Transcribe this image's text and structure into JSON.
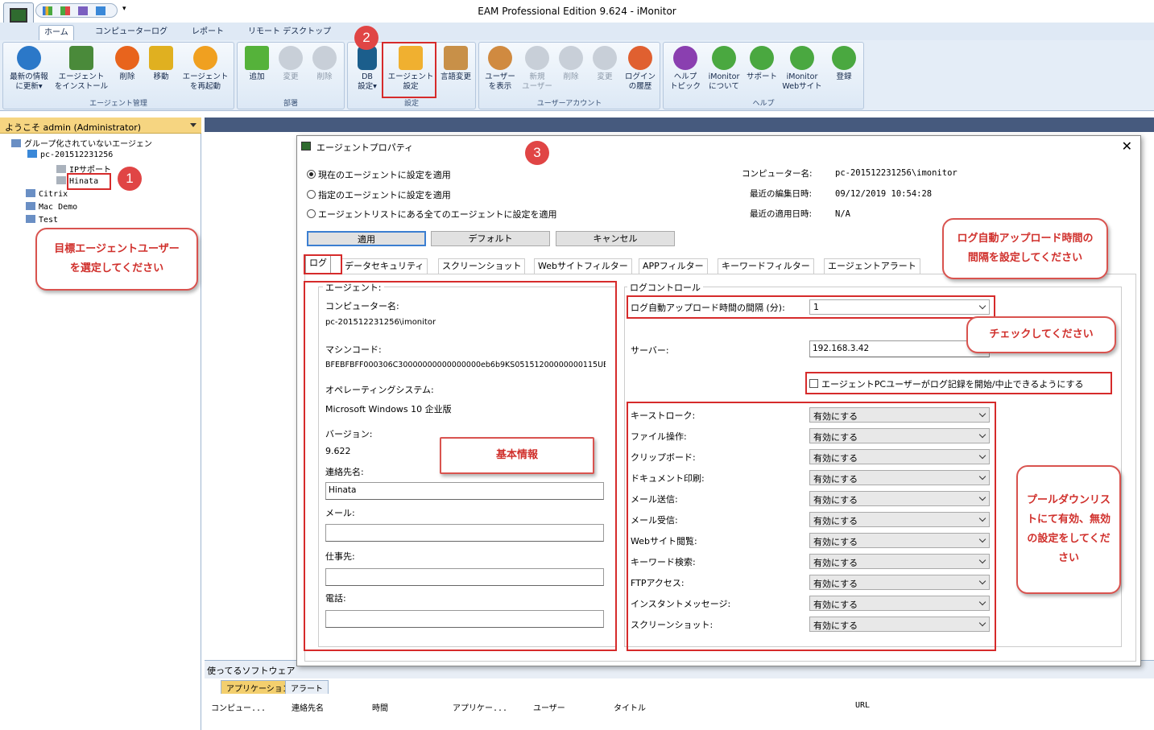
{
  "app": {
    "title": "EAM Professional Edition 9.624 - iMonitor"
  },
  "ribbon_tabs": [
    "ホーム",
    "コンピューターログ",
    "レポート",
    "リモート デスクトップ"
  ],
  "ribbon": {
    "groups": [
      {
        "label": "エージェント管理",
        "buttons": [
          {
            "l1": "最新の情報",
            "l2": "に更新▾",
            "icon": "refresh-icon",
            "color": "#2b78c8"
          },
          {
            "l1": "エージェント",
            "l2": "をインストール",
            "icon": "install-agent-icon",
            "color": "#4a8a3a"
          },
          {
            "l1": "削除",
            "l2": "",
            "icon": "delete-icon",
            "color": "#e8641d"
          },
          {
            "l1": "移動",
            "l2": "",
            "icon": "move-icon",
            "color": "#e0b020"
          },
          {
            "l1": "エージェント",
            "l2": "を再起動",
            "icon": "restart-icon",
            "color": "#f0a020"
          }
        ]
      },
      {
        "label": "部署",
        "buttons": [
          {
            "l1": "追加",
            "l2": "",
            "icon": "add-icon",
            "color": "#55b23a"
          },
          {
            "l1": "変更",
            "l2": "",
            "icon": "edit-icon",
            "color": "#c8cfd8"
          },
          {
            "l1": "削除",
            "l2": "",
            "icon": "delete-dept-icon",
            "color": "#c8cfd8"
          }
        ]
      },
      {
        "label": "設定",
        "buttons": [
          {
            "l1": "DB",
            "l2": "設定▾",
            "icon": "database-icon",
            "color": "#1b5e8c"
          },
          {
            "l1": "エージェント",
            "l2": "設定",
            "icon": "agent-settings-icon",
            "color": "#f0b030"
          },
          {
            "l1": "言語変更",
            "l2": "",
            "icon": "language-icon",
            "color": "#c89048"
          }
        ]
      },
      {
        "label": "ユーザーアカウント",
        "buttons": [
          {
            "l1": "ユーザー",
            "l2": "を表示",
            "icon": "users-icon",
            "color": "#d08a40"
          },
          {
            "l1": "新規",
            "l2": "ユーザー",
            "icon": "new-user-icon",
            "color": "#c8cfd8"
          },
          {
            "l1": "削除",
            "l2": "",
            "icon": "delete-user-icon",
            "color": "#c8cfd8"
          },
          {
            "l1": "変更",
            "l2": "",
            "icon": "edit-user-icon",
            "color": "#c8cfd8"
          },
          {
            "l1": "ログイン",
            "l2": "の履歴",
            "icon": "login-history-icon",
            "color": "#e06030"
          }
        ]
      },
      {
        "label": "ヘルプ",
        "buttons": [
          {
            "l1": "ヘルプ",
            "l2": "トピック",
            "icon": "help-icon",
            "color": "#8a3fb0"
          },
          {
            "l1": "iMonitor",
            "l2": "について",
            "icon": "about-icon",
            "color": "#4aa840"
          },
          {
            "l1": "サポート",
            "l2": "",
            "icon": "support-icon",
            "color": "#4aa840"
          },
          {
            "l1": "iMonitor",
            "l2": "Webサイト",
            "icon": "website-icon",
            "color": "#4aa840"
          },
          {
            "l1": "登録",
            "l2": "",
            "icon": "register-icon",
            "color": "#4aa840"
          }
        ]
      }
    ]
  },
  "left_panel": {
    "welcome": "ようこそ admin (Administrator)",
    "tree": [
      {
        "text": "グループ化されていないエージェン",
        "icon": "group-icon"
      },
      {
        "text": "pc-201512231256",
        "icon": "computer-icon"
      },
      {
        "text": "IPサポート",
        "icon": "user-icon"
      },
      {
        "text": "Hinata",
        "icon": "user-icon"
      },
      {
        "text": "Citrix",
        "icon": "group-icon"
      },
      {
        "text": "Mac Demo",
        "icon": "group-icon"
      },
      {
        "text": "Test",
        "icon": "group-icon"
      }
    ]
  },
  "bottom_panel": {
    "title": "使ってるソフトウェア",
    "tabs": [
      "アプリケーション",
      "アラート"
    ],
    "columns": [
      "コンピュー...",
      "連絡先名",
      "時間",
      "アプリケー...",
      "ユーザー",
      "タイトル",
      "URL"
    ]
  },
  "dialog": {
    "title": "エージェントプロパティ",
    "radios": [
      "現在のエージェントに設定を適用",
      "指定のエージェントに設定を適用",
      "エージェントリストにある全てのエージェントに設定を適用"
    ],
    "info_labels": [
      "コンピューター名:",
      "最近の編集日時:",
      "最近の適用日時:"
    ],
    "info_values": [
      "pc-201512231256\\imonitor",
      "09/12/2019 10:54:28",
      "N/A"
    ],
    "buttons": {
      "apply": "適用",
      "default": "デフォルト",
      "cancel": "キャンセル"
    },
    "tabs": [
      "ログ",
      "データセキュリティ",
      "スクリーンショット",
      "Webサイトフィルター",
      "APPフィルター",
      "キーワードフィルター",
      "エージェントアラート"
    ],
    "agent": {
      "group": "エージェント:",
      "computer_name_label": "コンピューター名:",
      "computer_name": "pc-201512231256\\imonitor",
      "machine_code_label": "マシンコード:",
      "machine_code": "BFEBFBFF000306C30000000000000000eb6b9KS05151200000000115UE",
      "os_label": "オペレーティングシステム:",
      "os": "Microsoft Windows 10 企业版",
      "version_label": "バージョン:",
      "version": "9.622",
      "contact_label": "連絡先名:",
      "contact": "Hinata",
      "mail_label": "メール:",
      "mail": "",
      "work_label": "仕事先:",
      "work": "",
      "phone_label": "電話:",
      "phone": ""
    },
    "log_control": {
      "group": "ログコントロール",
      "upload_label": "ログ自動アップロード時間の間隔 (分):",
      "upload_value": "1",
      "server_label": "サーバー:",
      "server_value": "192.168.3.42",
      "checkbox": "エージェントPCユーザーがログ記録を開始/中止できるようにする",
      "items": [
        {
          "label": "キーストローク:",
          "value": "有効にする"
        },
        {
          "label": "ファイル操作:",
          "value": "有効にする"
        },
        {
          "label": "クリップボード:",
          "value": "有効にする"
        },
        {
          "label": "ドキュメント印刷:",
          "value": "有効にする"
        },
        {
          "label": "メール送信:",
          "value": "有効にする"
        },
        {
          "label": "メール受信:",
          "value": "有効にする"
        },
        {
          "label": "Webサイト閲覧:",
          "value": "有効にする"
        },
        {
          "label": "キーワード検索:",
          "value": "有効にする"
        },
        {
          "label": "FTPアクセス:",
          "value": "有効にする"
        },
        {
          "label": "インスタントメッセージ:",
          "value": "有効にする"
        },
        {
          "label": "スクリーンショット:",
          "value": "有効にする"
        }
      ]
    }
  },
  "annotations": {
    "num1": "1",
    "num2": "2",
    "num3": "3",
    "callout_select": "目標エージェントユーザーを選定してください",
    "callout_basic": "基本情報",
    "callout_interval": "ログ自動アップロード時間の間隔を設定してください",
    "callout_check": "チェックしてください",
    "callout_pulldown": "プールダウンリストにて有効、無効の設定をしてください"
  },
  "colors": {
    "accent_red": "#d62b2b",
    "ribbon_bg": "#e4edf7",
    "welcome_bg": "#f6d581"
  }
}
